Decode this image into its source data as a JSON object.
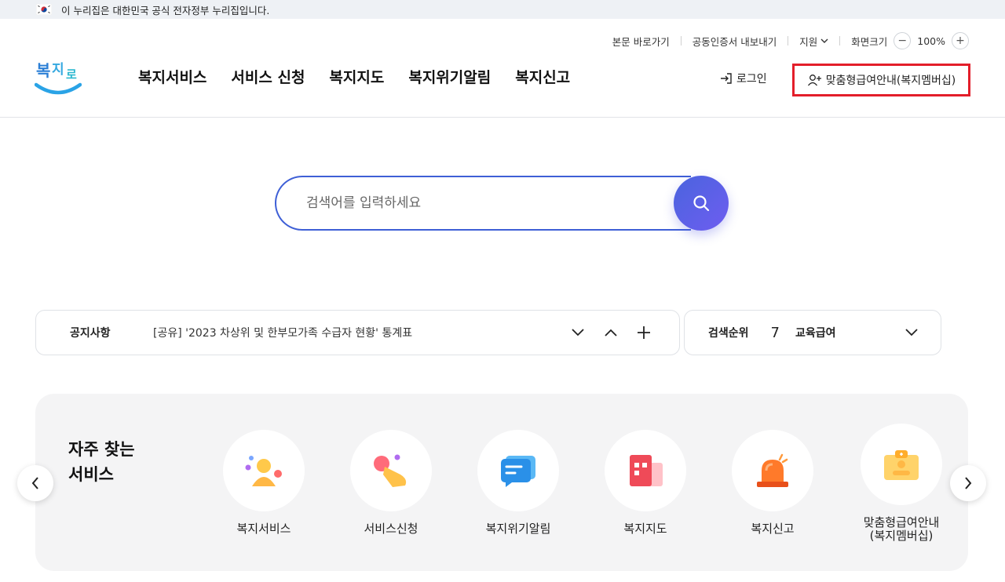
{
  "gov_banner": {
    "text": "이 누리집은 대한민국 공식 전자정부 누리집입니다."
  },
  "utility": {
    "skip_link": "본문 바로가기",
    "cert_export": "공동인증서 내보내기",
    "support": "지원",
    "zoom_label": "화면크기",
    "zoom_value": "100%"
  },
  "logo": {
    "text": "복지로"
  },
  "gnb": [
    "복지서비스",
    "서비스 신청",
    "복지지도",
    "복지위기알림",
    "복지신고"
  ],
  "header_actions": {
    "login": "로그인",
    "membership": "맞춤형급여안내(복지멤버십)"
  },
  "search": {
    "placeholder": "검색어를 입력하세요"
  },
  "notice": {
    "label": "공지사항",
    "text": "[공유] '2023 차상위 및 한부모가족 수급자 현황' 통계표"
  },
  "ranking": {
    "label": "검색순위",
    "rank": "7",
    "item": "교육급여"
  },
  "quick": {
    "title_line1": "자주 찾는",
    "title_line2": "서비스",
    "items": [
      {
        "label": "복지서비스",
        "icon": "people-icon"
      },
      {
        "label": "서비스신청",
        "icon": "hand-tap-icon"
      },
      {
        "label": "복지위기알림",
        "icon": "message-icon"
      },
      {
        "label": "복지지도",
        "icon": "map-icon"
      },
      {
        "label": "복지신고",
        "icon": "siren-icon"
      },
      {
        "label_line1": "맞춤형급여안내",
        "label_line2": "(복지멤버십)",
        "icon": "id-card-icon"
      }
    ]
  },
  "colors": {
    "accent": "#3e5fd6",
    "highlight": "#e31e2a"
  }
}
